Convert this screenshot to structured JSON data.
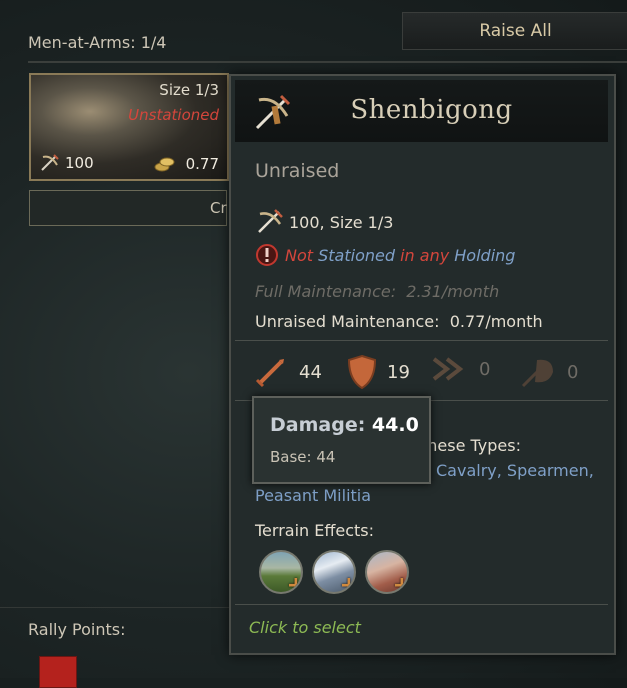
{
  "background": {
    "men_at_arms_label": "Men-at-Arms: 1/4",
    "raise_all_label": "Raise All",
    "rally_points_label": "Rally Points:",
    "card": {
      "size": "Size 1/3",
      "status": "Unstationed",
      "soldiers": "100",
      "cost": "0.77",
      "below_button_text": "Cr"
    }
  },
  "tooltip": {
    "title": "Shenbigong",
    "state": "Unraised",
    "soldiers_size": "100,  Size 1/3",
    "station": {
      "not": "Not",
      "stationed": " Stationed ",
      "in_any": "in any",
      "holding": " Holding"
    },
    "full_maintenance": "Full Maintenance:  2.31/month",
    "unraised_maintenance": "Unraised Maintenance:  0.77/month",
    "stats": {
      "damage": "44",
      "toughness": "19",
      "pursuit": "0",
      "screen": "0"
    },
    "against_types_partial": "these Types:",
    "against_values_partial": "Cavalry, Spearmen,",
    "against_militia": "Peasant Militia",
    "terrain_effects_label": "Terrain Effects:",
    "terrain_icons": [
      "hills-terrain-icon",
      "mountains-terrain-icon",
      "desert-mountains-terrain-icon"
    ],
    "click_to_select": "Click to select"
  },
  "damage_tooltip": {
    "label": "Damage: ",
    "value": "44.0",
    "base": "Base: 44"
  },
  "colors": {
    "negative_red": "#d4463c",
    "link_blue": "#7fa0c8",
    "hint_green": "#8dba54"
  }
}
